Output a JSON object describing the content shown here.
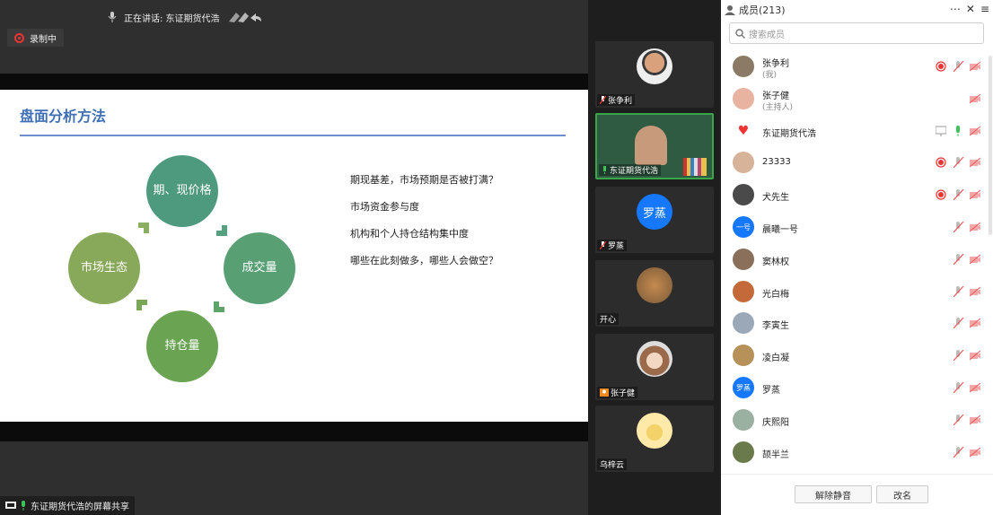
{
  "stage": {
    "speaking": "正在讲话: 东证期货代浩",
    "recording": "录制中",
    "share_label": "东证期货代浩的屏幕共享"
  },
  "slide": {
    "title": "盘面分析方法",
    "nodes": {
      "top": "期、现价格",
      "right": "成交量",
      "bottom": "持仓量",
      "left": "市场生态"
    },
    "bullets": [
      "期现基差，市场预期是否被打满？",
      "市场资金参与度",
      "机构和个人持仓结构集中度",
      "哪些在此刻做多，哪些人会做空？"
    ],
    "colors": {
      "top": "#4e9a7f",
      "right": "#58a074",
      "bottom": "#6aa453",
      "left": "#88a85a",
      "title": "#3f6fb7"
    }
  },
  "video_tiles": [
    {
      "name": "张争利",
      "avatar_icon": "boy-photo-icon",
      "mic": "muted"
    },
    {
      "name": "东证期货代浩",
      "avatar_icon": "man-video-icon",
      "mic": "active"
    },
    {
      "name": "罗蒸",
      "avatar_text": "罗蒸",
      "mic": "muted"
    },
    {
      "name": "开心",
      "avatar_icon": "photo-icon"
    },
    {
      "name": "张子健",
      "avatar_icon": "anime-girl-icon"
    },
    {
      "name": "乌梓云",
      "avatar_icon": "cartoon-icon"
    }
  ],
  "panel": {
    "title": "成员(213)",
    "search_placeholder": "搜索成员",
    "members": [
      {
        "name": "张争利",
        "sub": "(我)",
        "rec": true,
        "mic": "muted",
        "cam": "off"
      },
      {
        "name": "张子健",
        "sub": "(主持人)",
        "rec": false,
        "mic": "none",
        "cam": "off"
      },
      {
        "name": "东证期货代浩",
        "sub": "",
        "rec": false,
        "mic": "on",
        "cam": "off",
        "screen": true
      },
      {
        "name": "23333",
        "sub": "",
        "rec": true,
        "mic": "muted",
        "cam": "off"
      },
      {
        "name": "犬先生",
        "sub": "",
        "rec": true,
        "mic": "muted",
        "cam": "off"
      },
      {
        "name": "晨曦一号",
        "sub": "",
        "rec": false,
        "mic": "muted",
        "cam": "off",
        "avatar_text": "一号"
      },
      {
        "name": "窦林权",
        "sub": "",
        "rec": false,
        "mic": "muted",
        "cam": "off"
      },
      {
        "name": "光白梅",
        "sub": "",
        "rec": false,
        "mic": "muted",
        "cam": "off"
      },
      {
        "name": "李寅生",
        "sub": "",
        "rec": false,
        "mic": "muted",
        "cam": "off"
      },
      {
        "name": "凌白凝",
        "sub": "",
        "rec": false,
        "mic": "muted",
        "cam": "off"
      },
      {
        "name": "罗蒸",
        "sub": "",
        "rec": false,
        "mic": "muted",
        "cam": "off",
        "avatar_text": "罗蒸"
      },
      {
        "name": "庆熙阳",
        "sub": "",
        "rec": false,
        "mic": "muted",
        "cam": "off"
      },
      {
        "name": "颉半兰",
        "sub": "",
        "rec": false,
        "mic": "muted",
        "cam": "off"
      }
    ],
    "unmute_label": "解除静音",
    "rename_label": "改名"
  }
}
